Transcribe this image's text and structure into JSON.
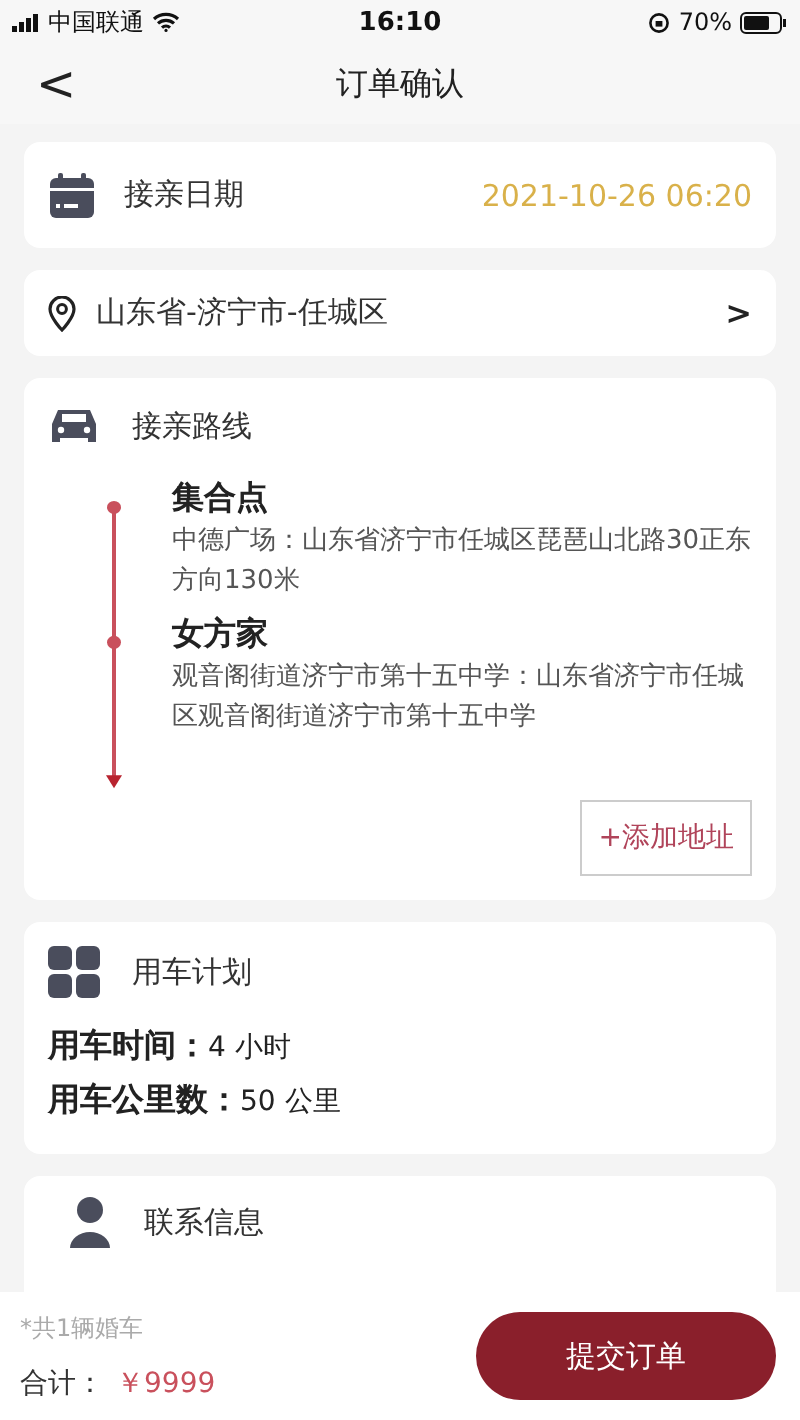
{
  "status_bar": {
    "carrier": "中国联通",
    "time": "16:10",
    "battery": "70%"
  },
  "nav": {
    "back": "<",
    "title": "订单确认"
  },
  "date_card": {
    "label": "接亲日期",
    "value": "2021-10-26 06:20"
  },
  "region": {
    "text": "山东省-济宁市-任城区",
    "chevron": ">"
  },
  "route": {
    "title": "接亲路线",
    "stops": [
      {
        "name": "集合点",
        "address": "中德广场：山东省济宁市任城区琵琶山北路30正东方向130米"
      },
      {
        "name": "女方家",
        "address": "观音阁街道济宁市第十五中学：山东省济宁市任城区观音阁街道济宁市第十五中学"
      }
    ],
    "add_button": "+添加地址"
  },
  "plan": {
    "title": "用车计划",
    "rows": [
      {
        "label": "用车时间：",
        "value": "4 小时"
      },
      {
        "label": "用车公里数：",
        "value": "50 公里"
      }
    ]
  },
  "contact": {
    "title": "联系信息"
  },
  "footer": {
    "note": "*共1辆婚车",
    "total_label": "合计：",
    "total": "￥9999",
    "submit": "提交订单"
  }
}
